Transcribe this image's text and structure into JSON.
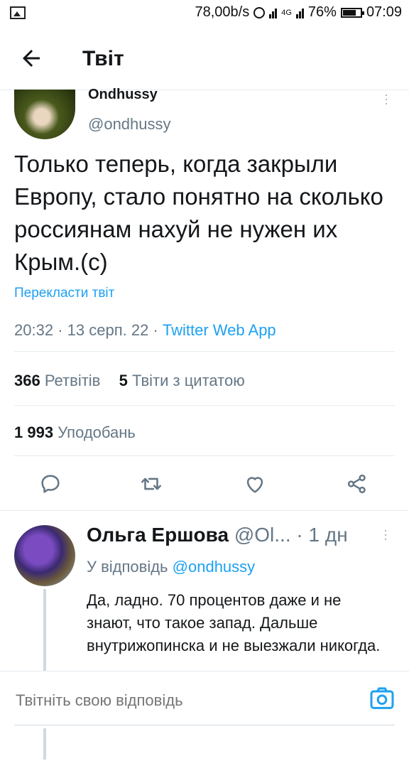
{
  "statusbar": {
    "speed": "78,00b/s",
    "network": "4G",
    "battery": "76%",
    "time": "07:09",
    "battery_level": 0.76
  },
  "header": {
    "title": "Твіт"
  },
  "tweet": {
    "author_name": "Ondhussy",
    "author_handle": "@ondhussy",
    "text": "Только теперь, когда закрыли Европу, стало понятно на сколько россиянам нахуй не нужен их Крым.(с)",
    "translate_label": "Перекласти твіт",
    "time": "20:32",
    "date": "13 серп. 22",
    "source": "Twitter Web App",
    "retweets_count": "366",
    "retweets_label": "Ретвітів",
    "quotes_count": "5",
    "quotes_label": "Твіти з цитатою",
    "likes_count": "1 993",
    "likes_label": "Уподобань"
  },
  "actions": {
    "icons": [
      "reply-icon",
      "retweet-icon",
      "like-icon",
      "share-icon"
    ]
  },
  "reply": {
    "name": "Ольга Ершова",
    "handle": "@Ol...",
    "age": "1 дн",
    "reply_to_label": "У відповідь",
    "reply_to_handle": "@ondhussy",
    "text": "Да, ладно. 70 процентов даже и не знают, что такое запад. Дальше внутрижопинска и не выезжали никогда."
  },
  "compose": {
    "placeholder": "Твітніть свою відповідь"
  },
  "colors": {
    "accent": "#1da1f2",
    "secondary_text": "#657786",
    "divider": "#e6ecf0"
  }
}
